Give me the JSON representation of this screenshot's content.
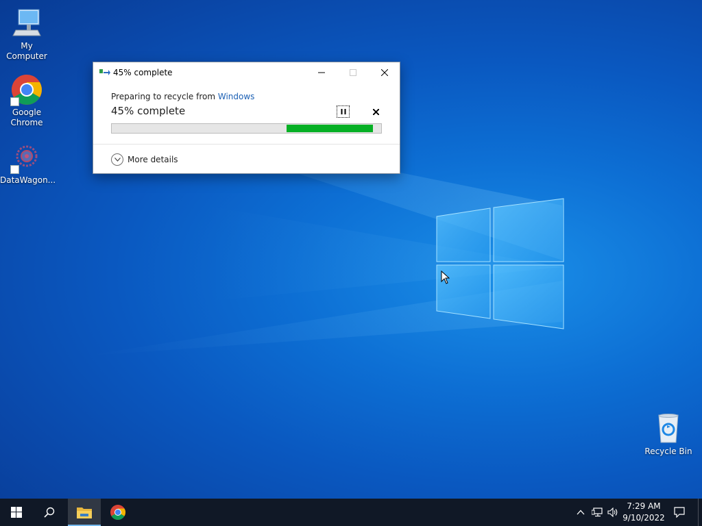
{
  "desktop": {
    "icons": [
      {
        "label": "My Computer",
        "icon": "computer-icon"
      },
      {
        "label": "Google Chrome",
        "icon": "chrome-icon"
      },
      {
        "label": "DataWagon...",
        "icon": "datawagon-icon"
      },
      {
        "label": "Recycle Bin",
        "icon": "recycle-bin-icon"
      }
    ]
  },
  "dialog": {
    "title": "45% complete",
    "status_prefix": "Preparing to recycle from",
    "status_link": "Windows",
    "percent_text": "45% complete",
    "progress_segment": {
      "start": 0.65,
      "end": 0.97
    },
    "more_details": "More details",
    "buttons": {
      "minimize": "minimize-icon",
      "maximize": "maximize-icon",
      "close": "close-icon",
      "pause": "pause-icon",
      "cancel": "cancel-icon"
    }
  },
  "taskbar": {
    "pinned": [
      "start-icon",
      "search-icon",
      "file-explorer-icon",
      "chrome-icon"
    ],
    "tray": [
      "chevron-up-icon",
      "network-icon",
      "volume-icon",
      "notifications-icon"
    ],
    "clock": {
      "time": "7:29 AM",
      "date": "9/10/2022"
    }
  },
  "colors": {
    "accent": "#06b025",
    "link": "#1a5fb4",
    "taskbar": "#101826",
    "wallpaper": "#0a58c0"
  }
}
